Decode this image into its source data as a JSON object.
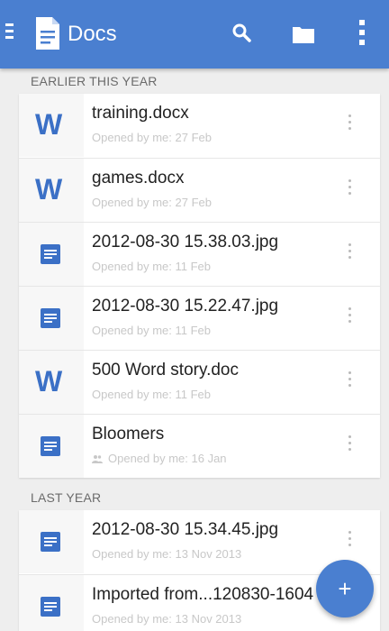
{
  "appbar": {
    "title": "Docs",
    "icons": [
      "menu-icon",
      "docs-logo-icon",
      "search-icon",
      "folder-icon",
      "more-vert-icon"
    ],
    "color": "#4a7fd0"
  },
  "sections": [
    {
      "header": "EARLIER THIS YEAR",
      "items": [
        {
          "name": "training.docx",
          "meta": "Opened by me: 27 Feb",
          "icon": "word-icon"
        },
        {
          "name": "games.docx",
          "meta": "Opened by me: 27 Feb",
          "icon": "word-icon"
        },
        {
          "name": "2012-08-30 15.38.03.jpg",
          "meta": "Opened by me: 11 Feb",
          "icon": "doc-icon"
        },
        {
          "name": "2012-08-30 15.22.47.jpg",
          "meta": "Opened by me: 11 Feb",
          "icon": "doc-icon"
        },
        {
          "name": "500 Word story.doc",
          "meta": "Opened by me: 11 Feb",
          "icon": "word-icon"
        },
        {
          "name": "Bloomers",
          "meta": "Opened by me: 16 Jan",
          "icon": "doc-icon",
          "shared": true
        }
      ]
    },
    {
      "header": "LAST YEAR",
      "items": [
        {
          "name": "2012-08-30 15.34.45.jpg",
          "meta": "Opened by me: 13 Nov 2013",
          "icon": "doc-icon"
        },
        {
          "name": "Imported from...120830-1604",
          "meta": "Opened by me: 13 Nov 2013",
          "icon": "doc-icon"
        }
      ]
    }
  ],
  "fab": {
    "label": "+",
    "icon": "add-icon"
  }
}
